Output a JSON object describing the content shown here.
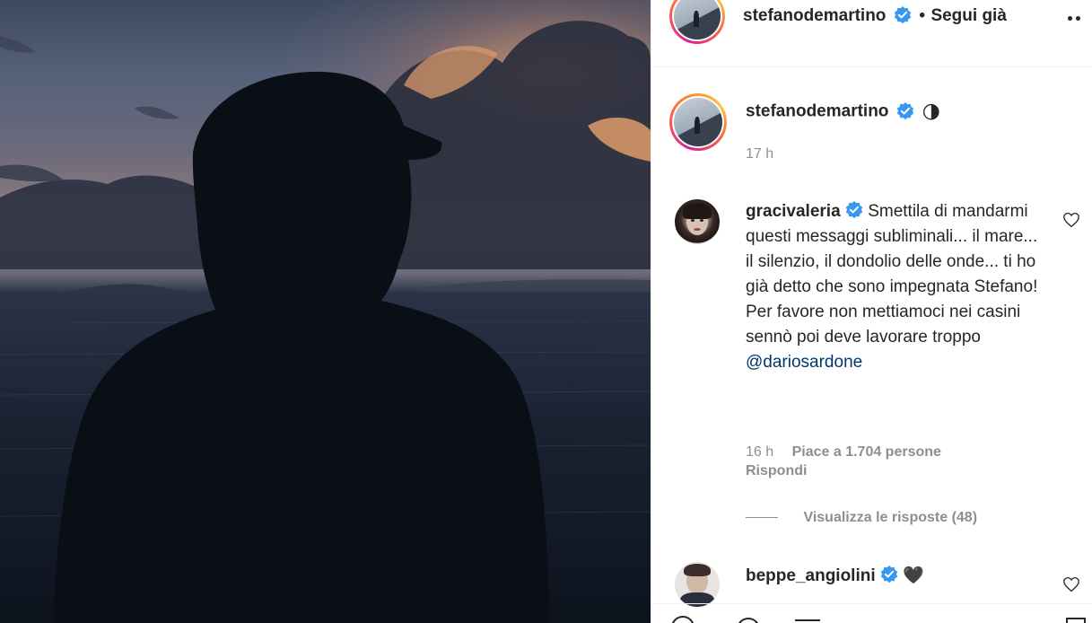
{
  "header": {
    "username": "stefanodemartino",
    "separator": "•",
    "follow_label": "Segui già"
  },
  "caption": {
    "username": "stefanodemartino",
    "emoji": "🌗",
    "time": "17 h"
  },
  "comments": [
    {
      "username": "gracivaleria",
      "text": "Smettila di mandarmi questi messaggi subliminali... il mare... il silenzio, il dondolio delle onde... ti ho già detto che sono impegnata Stefano! Per favore non mettiamoci nei casini sennò poi deve lavorare troppo",
      "mention": "@dariosardone",
      "time": "16 h",
      "likes": "Piace a 1.704 persone",
      "reply_label": "Rispondi",
      "view_replies": "Visualizza le risposte (48)"
    },
    {
      "username": "beppe_angiolini",
      "emoji": "🖤"
    }
  ],
  "colors": {
    "verified": "#3897f0",
    "text": "#262626",
    "muted": "#8e8e8e",
    "mention": "#00376b"
  }
}
